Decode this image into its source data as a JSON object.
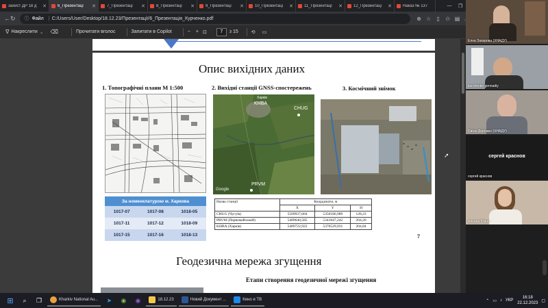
{
  "tabs": [
    {
      "label": "захист ДР 18 д",
      "active": false
    },
    {
      "label": "6_Презентаці",
      "active": false
    },
    {
      "label": "7_Презентаці",
      "active": false
    },
    {
      "label": "8_Презентаці",
      "active": false
    },
    {
      "label": "9_Презентаці",
      "active": false
    },
    {
      "label": "10_Презентаці",
      "active": false
    },
    {
      "label": "11_Презентаці",
      "active": false
    },
    {
      "label": "12_Презентаці",
      "active": false
    },
    {
      "label": "Наказ № 137",
      "active": false
    }
  ],
  "address": {
    "label": "Файл",
    "url": "C:/Users/User/Desktop/18.12.23/Презентації/6_Презентація_Курченко.pdf"
  },
  "pdf_toolbar": {
    "draw": "Накреслити",
    "read_aloud": "Прочитати вголос",
    "ask_copilot": "Запитати в Copilot",
    "zoom_minus": "−",
    "zoom_plus": "+",
    "page_current": "7",
    "page_total": "з 15"
  },
  "slide": {
    "title": "Опис вихідних даних",
    "section1": "1. Топографічні плани М 1:500",
    "section2": "2. Вихідні  станції GNSS-спостережень",
    "section3": "3. Космічний знімок",
    "map_labels": {
      "kharkiv": "Харків",
      "khva": "KHBA",
      "chug": "CHUG",
      "prvm": "PRVM",
      "google": "Google"
    },
    "nom_table": {
      "header": "За номенклатурою м. Харкова",
      "rows": [
        [
          "1017-07",
          "1017-08",
          "1018-05"
        ],
        [
          "1017-11",
          "1017-12",
          "1018-09"
        ],
        [
          "1017-15",
          "1017-16",
          "1018-13"
        ]
      ]
    },
    "coord_table": {
      "col_name": "Назва станції",
      "col_coords": "Координати, м",
      "col_x": "X",
      "col_y": "Y",
      "col_h": "H",
      "rows": [
        [
          "CHUG (Чугуїв)",
          "5509937,604",
          "5356186,989",
          "128,23"
        ],
        [
          "PRVM (Первомайський)",
          "5489640,585",
          "5341847,242",
          "204,20"
        ],
        [
          "KHBA (Харків)",
          "5489722,922",
          "5370529,931",
          "204,84"
        ]
      ]
    },
    "page_number": "7"
  },
  "next_slide": {
    "title": "Геодезична мережа згущення",
    "subtitle": "Етапи створення геодезичної мережі згущення"
  },
  "participants": [
    {
      "name": "Елна Захарова (ХНАДУ)",
      "video": true,
      "bg": "#5a4a3c"
    },
    {
      "name": "kurchenko gennadiy",
      "video": true,
      "bg": "#9aa0a6"
    },
    {
      "name": "Євген Дорожко (ХНАДУ)",
      "video": true,
      "bg": "#a09a92"
    },
    {
      "name": "сергей краснов",
      "video": false,
      "bg": "#1a1a1a"
    },
    {
      "name": "Альона Юхно",
      "video": true,
      "bg": "#c8b8a8"
    }
  ],
  "taskbar": {
    "apps": [
      {
        "label": "Kharkiv National Au...",
        "color": "#e8a33d"
      },
      {
        "label": "18.12.23",
        "color": "#f2c94c"
      },
      {
        "label": "Новий Документ ...",
        "color": "#2b5797"
      },
      {
        "label": "Кино и ТВ",
        "color": "#1e88e5"
      }
    ],
    "lang": "УКР",
    "time": "16:18",
    "date": "22.12.2023"
  }
}
